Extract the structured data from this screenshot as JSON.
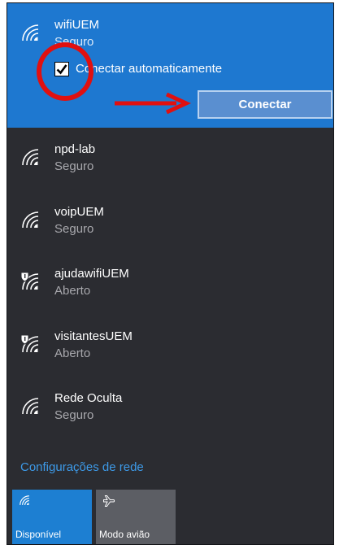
{
  "selected_network": {
    "name": "wifiUEM",
    "status": "Seguro",
    "auto_connect_label": "Conectar automaticamente",
    "auto_connect_checked": true,
    "connect_label": "Conectar"
  },
  "networks": [
    {
      "name": "npd-lab",
      "status": "Seguro",
      "icon": "wifi-secured-icon"
    },
    {
      "name": "voipUEM",
      "status": "Seguro",
      "icon": "wifi-secured-icon"
    },
    {
      "name": "ajudawifiUEM",
      "status": "Aberto",
      "icon": "wifi-open-shield-icon"
    },
    {
      "name": "visitantesUEM",
      "status": "Aberto",
      "icon": "wifi-open-shield-icon"
    },
    {
      "name": "Rede Oculta",
      "status": "Seguro",
      "icon": "wifi-secured-icon"
    }
  ],
  "settings_link": "Configurações de rede",
  "tiles": [
    {
      "label": "Disponível",
      "icon": "wifi-icon",
      "active": true
    },
    {
      "label": "Modo avião",
      "icon": "airplane-icon",
      "active": false
    }
  ],
  "colors": {
    "accent": "#1e78d0",
    "panel_bg": "#2b2c31",
    "link": "#3d9ae8",
    "annotation": "#e01010"
  }
}
